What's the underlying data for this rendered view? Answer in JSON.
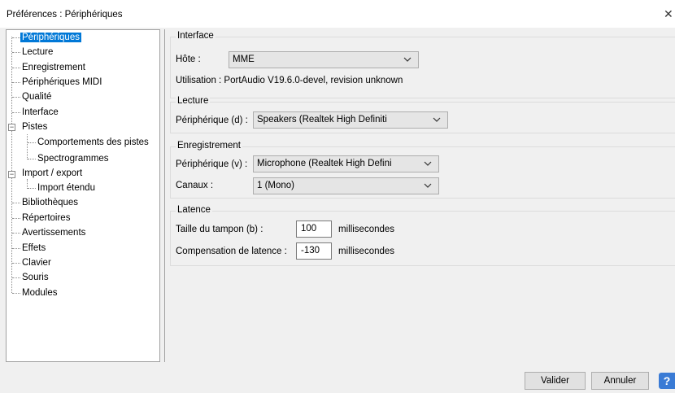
{
  "window": {
    "title": "Préférences : Périphériques"
  },
  "tree": {
    "items": [
      {
        "label": "Périphériques"
      },
      {
        "label": "Lecture"
      },
      {
        "label": "Enregistrement"
      },
      {
        "label": "Périphériques MIDI"
      },
      {
        "label": "Qualité"
      },
      {
        "label": "Interface"
      },
      {
        "label": "Pistes"
      },
      {
        "label": "Comportements des pistes"
      },
      {
        "label": "Spectrogrammes"
      },
      {
        "label": "Import / export"
      },
      {
        "label": "Import étendu"
      },
      {
        "label": "Bibliothèques"
      },
      {
        "label": "Répertoires"
      },
      {
        "label": "Avertissements"
      },
      {
        "label": "Effets"
      },
      {
        "label": "Clavier"
      },
      {
        "label": "Souris"
      },
      {
        "label": "Modules"
      }
    ]
  },
  "interface": {
    "title": "Interface",
    "host_label": "Hôte :",
    "host_value": "MME",
    "usage": "Utilisation : PortAudio V19.6.0-devel, revision unknown"
  },
  "playback": {
    "title": "Lecture",
    "device_label": "Périphérique (d) :",
    "device_value": "Speakers (Realtek High Definiti"
  },
  "recording": {
    "title": "Enregistrement",
    "device_label": "Périphérique (v) :",
    "device_value": "Microphone (Realtek High Defini",
    "channels_label": "Canaux :",
    "channels_value": "1 (Mono)"
  },
  "latency": {
    "title": "Latence",
    "buffer_label": "Taille du tampon (b) :",
    "buffer_value": "100",
    "buffer_unit": "millisecondes",
    "compensation_label": "Compensation de latence :",
    "compensation_value": "-130",
    "compensation_unit": "millisecondes"
  },
  "buttons": {
    "ok": "Valider",
    "cancel": "Annuler"
  },
  "colors": {
    "selection": "#0078d7",
    "help": "#3a7bd5"
  }
}
